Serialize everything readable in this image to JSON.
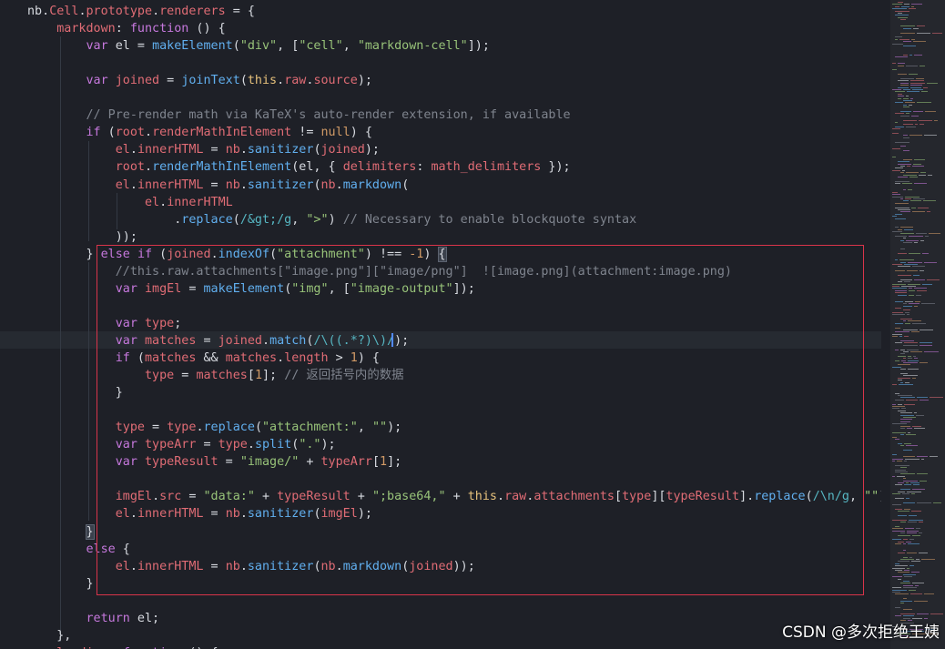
{
  "editor": {
    "theme_colors": {
      "background": "#1e2027",
      "keyword": "#c678dd",
      "function": "#61afef",
      "string": "#98c379",
      "property": "#e06c75",
      "number": "#d19a66",
      "comment": "#7f848e",
      "highlight_box": "#d9344a"
    },
    "lines": [
      [
        [
          "nb",
          "pn"
        ],
        [
          ".",
          "pn"
        ],
        [
          "Cell",
          "prm"
        ],
        [
          ".",
          "pn"
        ],
        [
          "prototype",
          "prm"
        ],
        [
          ".",
          "pn"
        ],
        [
          "renderers",
          "prm"
        ],
        [
          " = {",
          "pn"
        ]
      ],
      [
        [
          "    ",
          "pn"
        ],
        [
          "markdown",
          "prm"
        ],
        [
          ": ",
          "pn"
        ],
        [
          "function",
          "kw"
        ],
        [
          " () {",
          "pn"
        ]
      ],
      [
        [
          "        ",
          "pn"
        ],
        [
          "var",
          "kw"
        ],
        [
          " el = ",
          "pn"
        ],
        [
          "makeElement",
          "fn"
        ],
        [
          "(",
          "pn"
        ],
        [
          "\"div\"",
          "str"
        ],
        [
          ", [",
          "pn"
        ],
        [
          "\"cell\"",
          "str"
        ],
        [
          ", ",
          "pn"
        ],
        [
          "\"markdown-cell\"",
          "str"
        ],
        [
          "]);",
          "pn"
        ]
      ],
      [
        [
          "",
          "pn"
        ]
      ],
      [
        [
          "        ",
          "pn"
        ],
        [
          "var",
          "kw"
        ],
        [
          " ",
          "pn"
        ],
        [
          "joined",
          "prm"
        ],
        [
          " = ",
          "pn"
        ],
        [
          "joinText",
          "fn"
        ],
        [
          "(",
          "pn"
        ],
        [
          "this",
          "yw"
        ],
        [
          ".",
          "pn"
        ],
        [
          "raw",
          "prm"
        ],
        [
          ".",
          "pn"
        ],
        [
          "source",
          "prm"
        ],
        [
          ");",
          "pn"
        ]
      ],
      [
        [
          "",
          "pn"
        ]
      ],
      [
        [
          "        ",
          "pn"
        ],
        [
          "// Pre-render math via KaTeX's auto-render extension, if available",
          "cm"
        ]
      ],
      [
        [
          "        ",
          "pn"
        ],
        [
          "if",
          "kw"
        ],
        [
          " (",
          "pn"
        ],
        [
          "root",
          "prm"
        ],
        [
          ".",
          "pn"
        ],
        [
          "renderMathInElement",
          "prm"
        ],
        [
          " != ",
          "pn"
        ],
        [
          "null",
          "num"
        ],
        [
          ") {",
          "pn"
        ]
      ],
      [
        [
          "            ",
          "pn"
        ],
        [
          "el",
          "prm"
        ],
        [
          ".",
          "pn"
        ],
        [
          "innerHTML",
          "prm"
        ],
        [
          " = ",
          "pn"
        ],
        [
          "nb",
          "prm"
        ],
        [
          ".",
          "pn"
        ],
        [
          "sanitizer",
          "fn"
        ],
        [
          "(",
          "pn"
        ],
        [
          "joined",
          "prm"
        ],
        [
          ");",
          "pn"
        ]
      ],
      [
        [
          "            ",
          "pn"
        ],
        [
          "root",
          "prm"
        ],
        [
          ".",
          "pn"
        ],
        [
          "renderMathInElement",
          "fn"
        ],
        [
          "(el, { ",
          "pn"
        ],
        [
          "delimiters",
          "prm"
        ],
        [
          ": ",
          "pn"
        ],
        [
          "math_delimiters",
          "prm"
        ],
        [
          " });",
          "pn"
        ]
      ],
      [
        [
          "            ",
          "pn"
        ],
        [
          "el",
          "prm"
        ],
        [
          ".",
          "pn"
        ],
        [
          "innerHTML",
          "prm"
        ],
        [
          " = ",
          "pn"
        ],
        [
          "nb",
          "prm"
        ],
        [
          ".",
          "pn"
        ],
        [
          "sanitizer",
          "fn"
        ],
        [
          "(",
          "pn"
        ],
        [
          "nb",
          "prm"
        ],
        [
          ".",
          "pn"
        ],
        [
          "markdown",
          "fn"
        ],
        [
          "(",
          "pn"
        ]
      ],
      [
        [
          "                ",
          "pn"
        ],
        [
          "el",
          "prm"
        ],
        [
          ".",
          "pn"
        ],
        [
          "innerHTML",
          "prm"
        ]
      ],
      [
        [
          "                    .",
          "pn"
        ],
        [
          "replace",
          "fn"
        ],
        [
          "(",
          "pn"
        ],
        [
          "/&gt;/g",
          "op"
        ],
        [
          ", ",
          "pn"
        ],
        [
          "\">\"",
          "str"
        ],
        [
          ") ",
          "pn"
        ],
        [
          "// Necessary to enable blockquote syntax",
          "cm"
        ]
      ],
      [
        [
          "            ));",
          "pn"
        ]
      ],
      [
        [
          "        } ",
          "pn"
        ],
        [
          "else",
          "kw"
        ],
        [
          " ",
          "pn"
        ],
        [
          "if",
          "kw"
        ],
        [
          " (",
          "pn"
        ],
        [
          "joined",
          "prm"
        ],
        [
          ".",
          "pn"
        ],
        [
          "indexOf",
          "fn"
        ],
        [
          "(",
          "pn"
        ],
        [
          "\"attachment\"",
          "str"
        ],
        [
          ") !== ",
          "pn"
        ],
        [
          "-1",
          "num"
        ],
        [
          ") ",
          "pn"
        ],
        [
          "{",
          "bk"
        ]
      ],
      [
        [
          "            ",
          "pn"
        ],
        [
          "//this.raw.attachments[\"image.png\"][\"image/png\"]  ![image.png](attachment:image.png)",
          "cm"
        ]
      ],
      [
        [
          "            ",
          "pn"
        ],
        [
          "var",
          "kw"
        ],
        [
          " ",
          "pn"
        ],
        [
          "imgEl",
          "prm"
        ],
        [
          " = ",
          "pn"
        ],
        [
          "makeElement",
          "fn"
        ],
        [
          "(",
          "pn"
        ],
        [
          "\"img\"",
          "str"
        ],
        [
          ", [",
          "pn"
        ],
        [
          "\"image-output\"",
          "str"
        ],
        [
          "]);",
          "pn"
        ]
      ],
      [
        [
          "",
          "pn"
        ]
      ],
      [
        [
          "            ",
          "pn"
        ],
        [
          "var",
          "kw"
        ],
        [
          " ",
          "pn"
        ],
        [
          "type",
          "prm"
        ],
        [
          ";",
          "pn"
        ]
      ],
      [
        [
          "            ",
          "pn"
        ],
        [
          "var",
          "kw"
        ],
        [
          " ",
          "pn"
        ],
        [
          "matches",
          "prm"
        ],
        [
          " = ",
          "pn"
        ],
        [
          "joined",
          "prm"
        ],
        [
          ".",
          "pn"
        ],
        [
          "match",
          "fn"
        ],
        [
          "(",
          "pn"
        ],
        [
          "/\\((.*?)\\)/",
          "op"
        ],
        [
          ");",
          "pn"
        ]
      ],
      [
        [
          "            ",
          "pn"
        ],
        [
          "if",
          "kw"
        ],
        [
          " (",
          "pn"
        ],
        [
          "matches",
          "prm"
        ],
        [
          " && ",
          "pn"
        ],
        [
          "matches",
          "prm"
        ],
        [
          ".",
          "pn"
        ],
        [
          "length",
          "prm"
        ],
        [
          " > ",
          "pn"
        ],
        [
          "1",
          "num"
        ],
        [
          ") {",
          "pn"
        ]
      ],
      [
        [
          "                ",
          "pn"
        ],
        [
          "type",
          "prm"
        ],
        [
          " = ",
          "pn"
        ],
        [
          "matches",
          "prm"
        ],
        [
          "[",
          "pn"
        ],
        [
          "1",
          "num"
        ],
        [
          "]; ",
          "pn"
        ],
        [
          "// 返回括号内的数据",
          "cm"
        ]
      ],
      [
        [
          "            }",
          "pn"
        ]
      ],
      [
        [
          "",
          "pn"
        ]
      ],
      [
        [
          "            ",
          "pn"
        ],
        [
          "type",
          "prm"
        ],
        [
          " = ",
          "pn"
        ],
        [
          "type",
          "prm"
        ],
        [
          ".",
          "pn"
        ],
        [
          "replace",
          "fn"
        ],
        [
          "(",
          "pn"
        ],
        [
          "\"attachment:\"",
          "str"
        ],
        [
          ", ",
          "pn"
        ],
        [
          "\"\"",
          "str"
        ],
        [
          ");",
          "pn"
        ]
      ],
      [
        [
          "            ",
          "pn"
        ],
        [
          "var",
          "kw"
        ],
        [
          " ",
          "pn"
        ],
        [
          "typeArr",
          "prm"
        ],
        [
          " = ",
          "pn"
        ],
        [
          "type",
          "prm"
        ],
        [
          ".",
          "pn"
        ],
        [
          "split",
          "fn"
        ],
        [
          "(",
          "pn"
        ],
        [
          "\".\"",
          "str"
        ],
        [
          ");",
          "pn"
        ]
      ],
      [
        [
          "            ",
          "pn"
        ],
        [
          "var",
          "kw"
        ],
        [
          " ",
          "pn"
        ],
        [
          "typeResult",
          "prm"
        ],
        [
          " = ",
          "pn"
        ],
        [
          "\"image/\"",
          "str"
        ],
        [
          " + ",
          "pn"
        ],
        [
          "typeArr",
          "prm"
        ],
        [
          "[",
          "pn"
        ],
        [
          "1",
          "num"
        ],
        [
          "];",
          "pn"
        ]
      ],
      [
        [
          "",
          "pn"
        ]
      ],
      [
        [
          "            ",
          "pn"
        ],
        [
          "imgEl",
          "prm"
        ],
        [
          ".",
          "pn"
        ],
        [
          "src",
          "prm"
        ],
        [
          " = ",
          "pn"
        ],
        [
          "\"data:\"",
          "str"
        ],
        [
          " + ",
          "pn"
        ],
        [
          "typeResult",
          "prm"
        ],
        [
          " + ",
          "pn"
        ],
        [
          "\";base64,\"",
          "str"
        ],
        [
          " + ",
          "pn"
        ],
        [
          "this",
          "yw"
        ],
        [
          ".",
          "pn"
        ],
        [
          "raw",
          "prm"
        ],
        [
          ".",
          "pn"
        ],
        [
          "attachments",
          "prm"
        ],
        [
          "[",
          "pn"
        ],
        [
          "type",
          "prm"
        ],
        [
          "][",
          "pn"
        ],
        [
          "typeResult",
          "prm"
        ],
        [
          "].",
          "pn"
        ],
        [
          "replace",
          "fn"
        ],
        [
          "(",
          "pn"
        ],
        [
          "/\\n/g",
          "op"
        ],
        [
          ", ",
          "pn"
        ],
        [
          "\"\"",
          "str"
        ],
        [
          ");",
          "pn"
        ]
      ],
      [
        [
          "            ",
          "pn"
        ],
        [
          "el",
          "prm"
        ],
        [
          ".",
          "pn"
        ],
        [
          "innerHTML",
          "prm"
        ],
        [
          " = ",
          "pn"
        ],
        [
          "nb",
          "prm"
        ],
        [
          ".",
          "pn"
        ],
        [
          "sanitizer",
          "fn"
        ],
        [
          "(",
          "pn"
        ],
        [
          "imgEl",
          "prm"
        ],
        [
          ");",
          "pn"
        ]
      ],
      [
        [
          "        ",
          "pn"
        ],
        [
          "}",
          "bk"
        ]
      ],
      [
        [
          "        ",
          "pn"
        ],
        [
          "else",
          "kw"
        ],
        [
          " {",
          "pn"
        ]
      ],
      [
        [
          "            ",
          "pn"
        ],
        [
          "el",
          "prm"
        ],
        [
          ".",
          "pn"
        ],
        [
          "innerHTML",
          "prm"
        ],
        [
          " = ",
          "pn"
        ],
        [
          "nb",
          "prm"
        ],
        [
          ".",
          "pn"
        ],
        [
          "sanitizer",
          "fn"
        ],
        [
          "(",
          "pn"
        ],
        [
          "nb",
          "prm"
        ],
        [
          ".",
          "pn"
        ],
        [
          "markdown",
          "fn"
        ],
        [
          "(",
          "pn"
        ],
        [
          "joined",
          "prm"
        ],
        [
          "));",
          "pn"
        ]
      ],
      [
        [
          "        }",
          "pn"
        ]
      ],
      [
        [
          "",
          "pn"
        ]
      ],
      [
        [
          "        ",
          "pn"
        ],
        [
          "return",
          "kw"
        ],
        [
          " el;",
          "pn"
        ]
      ],
      [
        [
          "    },",
          "pn"
        ]
      ],
      [
        [
          "    ",
          "pn"
        ],
        [
          "loading",
          "prm"
        ],
        [
          ": ",
          "pn"
        ],
        [
          "function",
          "kw"
        ],
        [
          " () {",
          "pn"
        ]
      ]
    ]
  },
  "watermark": "CSDN @多次拒绝王姨"
}
